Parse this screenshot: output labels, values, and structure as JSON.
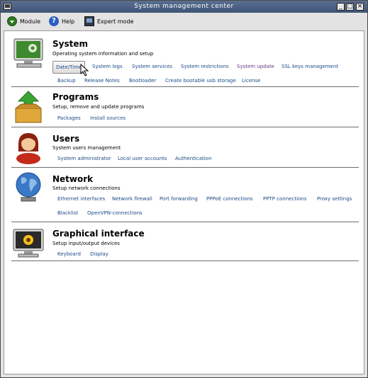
{
  "window": {
    "title": "System management center"
  },
  "toolbar": {
    "module_label": "Module",
    "help_label": "Help",
    "expert_label": "Expert mode"
  },
  "sections": [
    {
      "title": "System",
      "description": "Operating system information and setup",
      "links_row1": [
        "Date/Time",
        "System logs",
        "System services",
        "System restrictions",
        "System update",
        "SSL keys management"
      ],
      "links_row2": [
        "Backup",
        "Release Notes",
        "Bootloader",
        "Create bootable usb storage",
        "License"
      ]
    },
    {
      "title": "Programs",
      "description": "Setup, remove and update programs",
      "links_row1": [
        "Packages",
        "Install sources"
      ]
    },
    {
      "title": "Users",
      "description": "System users management",
      "links_row1": [
        "System administrator",
        "Local user accounts",
        "Authentication"
      ]
    },
    {
      "title": "Network",
      "description": "Setup network connections",
      "links_row1": [
        "Ethernet interfaces",
        "Network firewall",
        "Port forwarding",
        "PPPoE connections",
        "PPTP connections",
        "Proxy settings"
      ],
      "links_row2": [
        "Blacklist",
        "OpenVPN-connections"
      ]
    },
    {
      "title": "Graphical interface",
      "description": "Setup input/output devices",
      "links_row1": [
        "Keyboard",
        "Display"
      ]
    }
  ],
  "colors": {
    "titlebar": "#4a6088",
    "link": "#1a4a88",
    "visited_link": "#6a3a80",
    "separator": "#6e6e6e"
  },
  "icons": {
    "system": "monitor-gear-icon",
    "programs": "box-arrow-icon",
    "users": "user-icon",
    "network": "globe-icon",
    "graphical": "monitor-flower-icon"
  }
}
